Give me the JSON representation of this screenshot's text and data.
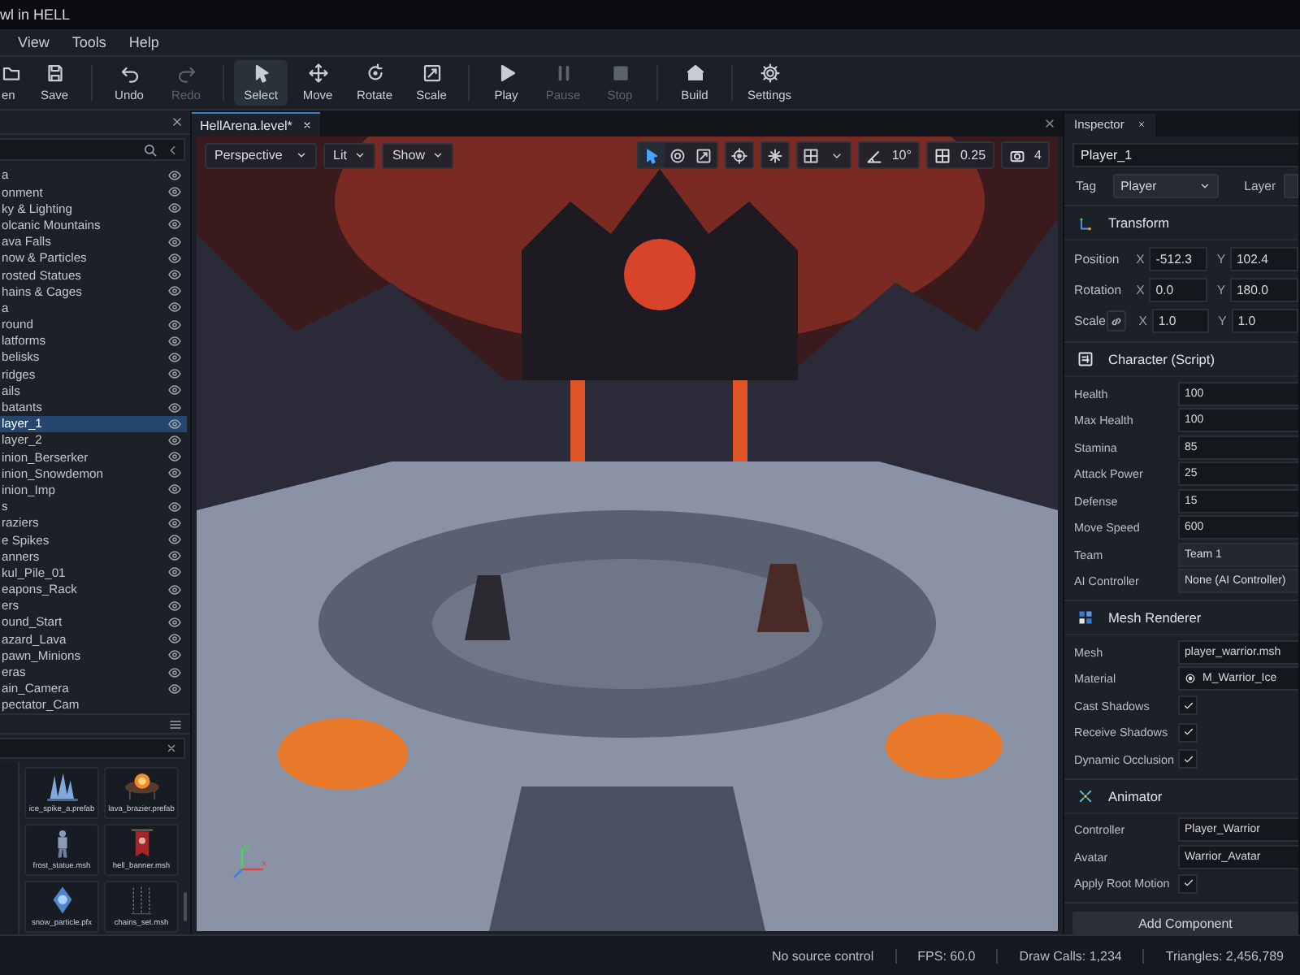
{
  "window": {
    "title": "wl in HELL"
  },
  "menu": [
    "View",
    "Tools",
    "Help"
  ],
  "toolbar": [
    {
      "label": "en",
      "kind": "open",
      "disabled": false,
      "selected": false,
      "group_end": false
    },
    {
      "label": "Save",
      "kind": "save",
      "disabled": false,
      "selected": false,
      "group_end": true
    },
    {
      "label": "Undo",
      "kind": "undo",
      "disabled": false,
      "selected": false,
      "group_end": false
    },
    {
      "label": "Redo",
      "kind": "redo",
      "disabled": true,
      "selected": false,
      "group_end": true
    },
    {
      "label": "Select",
      "kind": "select",
      "disabled": false,
      "selected": true,
      "group_end": false
    },
    {
      "label": "Move",
      "kind": "move",
      "disabled": false,
      "selected": false,
      "group_end": false
    },
    {
      "label": "Rotate",
      "kind": "rotate",
      "disabled": false,
      "selected": false,
      "group_end": false
    },
    {
      "label": "Scale",
      "kind": "scale",
      "disabled": false,
      "selected": false,
      "group_end": true
    },
    {
      "label": "Play",
      "kind": "play",
      "disabled": false,
      "selected": false,
      "group_end": false
    },
    {
      "label": "Pause",
      "kind": "pause",
      "disabled": true,
      "selected": false,
      "group_end": false
    },
    {
      "label": "Stop",
      "kind": "stop",
      "disabled": true,
      "selected": false,
      "group_end": true
    },
    {
      "label": "Build",
      "kind": "build",
      "disabled": false,
      "selected": false,
      "group_end": true
    },
    {
      "label": "Settings",
      "kind": "settings",
      "disabled": false,
      "selected": false,
      "group_end": false
    }
  ],
  "hierarchy": {
    "items": [
      {
        "label": "a",
        "visible": true,
        "selected": false
      },
      {
        "label": "onment",
        "visible": true,
        "selected": false
      },
      {
        "label": "ky & Lighting",
        "visible": true,
        "selected": false
      },
      {
        "label": "olcanic Mountains",
        "visible": true,
        "selected": false
      },
      {
        "label": "ava Falls",
        "visible": true,
        "selected": false
      },
      {
        "label": "now & Particles",
        "visible": true,
        "selected": false
      },
      {
        "label": "rosted Statues",
        "visible": true,
        "selected": false
      },
      {
        "label": "hains & Cages",
        "visible": true,
        "selected": false
      },
      {
        "label": "a",
        "visible": true,
        "selected": false
      },
      {
        "label": "round",
        "visible": true,
        "selected": false
      },
      {
        "label": "latforms",
        "visible": true,
        "selected": false
      },
      {
        "label": "belisks",
        "visible": true,
        "selected": false
      },
      {
        "label": "ridges",
        "visible": true,
        "selected": false
      },
      {
        "label": "ails",
        "visible": true,
        "selected": false
      },
      {
        "label": "batants",
        "visible": true,
        "selected": false
      },
      {
        "label": "layer_1",
        "visible": true,
        "selected": true
      },
      {
        "label": "layer_2",
        "visible": true,
        "selected": false
      },
      {
        "label": "inion_Berserker",
        "visible": true,
        "selected": false
      },
      {
        "label": "inion_Snowdemon",
        "visible": true,
        "selected": false
      },
      {
        "label": "inion_Imp",
        "visible": true,
        "selected": false
      },
      {
        "label": "s",
        "visible": true,
        "selected": false
      },
      {
        "label": "raziers",
        "visible": true,
        "selected": false
      },
      {
        "label": "e Spikes",
        "visible": true,
        "selected": false
      },
      {
        "label": "anners",
        "visible": true,
        "selected": false
      },
      {
        "label": "kul_Pile_01",
        "visible": true,
        "selected": false
      },
      {
        "label": "eapons_Rack",
        "visible": true,
        "selected": false
      },
      {
        "label": "ers",
        "visible": true,
        "selected": false
      },
      {
        "label": "ound_Start",
        "visible": true,
        "selected": false
      },
      {
        "label": "azard_Lava",
        "visible": true,
        "selected": false
      },
      {
        "label": "pawn_Minions",
        "visible": true,
        "selected": false
      },
      {
        "label": "eras",
        "visible": true,
        "selected": false
      },
      {
        "label": "ain_Camera",
        "visible": true,
        "selected": false
      },
      {
        "label": "pectator_Cam",
        "visible": false,
        "selected": false
      }
    ]
  },
  "assets": {
    "items": [
      {
        "label": "ice_spike_a.prefab",
        "kind": "picture"
      },
      {
        "label": "lava_brazier.prefab",
        "kind": "picture"
      },
      {
        "label": "frost_statue.msh",
        "kind": "picture"
      },
      {
        "label": "hell_banner.msh",
        "kind": "picture"
      },
      {
        "label": "snow_particle.pfx",
        "kind": "picture"
      },
      {
        "label": "chains_set.msh",
        "kind": "picture"
      }
    ]
  },
  "viewport": {
    "tab": {
      "label": "HellArena.level*",
      "selected": true
    },
    "view_modes": [
      "Perspective",
      "Lit",
      "Show"
    ],
    "tools": [
      {
        "kind": "select",
        "selected": true
      },
      {
        "kind": "orbit",
        "selected": false
      },
      {
        "kind": "scale",
        "selected": false
      },
      {
        "kind": "pivot",
        "selected": false
      },
      {
        "kind": "effects",
        "selected": false
      },
      {
        "kind": "grid",
        "selected": false
      }
    ],
    "snaps": [
      {
        "kind": "angle",
        "value": "10°"
      },
      {
        "kind": "grid",
        "value": "0.25"
      },
      {
        "kind": "camera",
        "value": "4"
      }
    ],
    "axis_labels": [
      "y",
      "x"
    ]
  },
  "inspector": {
    "tab": "Inspector",
    "name": "Player_1",
    "tag_label": "Tag",
    "tag": "Player",
    "layer_label": "Layer",
    "components": [
      {
        "title": "Transform",
        "kind": "transform",
        "rows": [
          {
            "kind": "vector",
            "label": "Position",
            "link": false,
            "axes": [
              {
                "axis": "X",
                "value": "-512.3"
              },
              {
                "axis": "Y",
                "value": "102.4"
              }
            ]
          },
          {
            "kind": "vector",
            "label": "Rotation",
            "link": false,
            "axes": [
              {
                "axis": "X",
                "value": "0.0"
              },
              {
                "axis": "Y",
                "value": "180.0"
              }
            ]
          },
          {
            "kind": "vector",
            "label": "Scale",
            "link": true,
            "axes": [
              {
                "axis": "X",
                "value": "1.0"
              },
              {
                "axis": "Y",
                "value": "1.0"
              }
            ]
          }
        ]
      },
      {
        "title": "Character (Script)",
        "kind": "script",
        "rows": [
          {
            "kind": "field",
            "label": "Health",
            "value": "100"
          },
          {
            "kind": "field",
            "label": "Max Health",
            "value": "100"
          },
          {
            "kind": "field",
            "label": "Stamina",
            "value": "85"
          },
          {
            "kind": "field",
            "label": "Attack Power",
            "value": "25"
          },
          {
            "kind": "field",
            "label": "Defense",
            "value": "15"
          },
          {
            "kind": "field",
            "label": "Move Speed",
            "value": "600"
          },
          {
            "kind": "dropdown",
            "label": "Team",
            "value": "Team 1"
          },
          {
            "kind": "dropdown",
            "label": "AI Controller",
            "value": "None (AI Controller)"
          }
        ]
      },
      {
        "title": "Mesh Renderer",
        "kind": "mesh",
        "rows": [
          {
            "kind": "field",
            "label": "Mesh",
            "value": "player_warrior.msh"
          },
          {
            "kind": "object",
            "label": "Material",
            "value": "M_Warrior_Ice"
          },
          {
            "kind": "check",
            "label": "Cast Shadows",
            "checked": true
          },
          {
            "kind": "check",
            "label": "Receive Shadows",
            "checked": true
          },
          {
            "kind": "check",
            "label": "Dynamic Occlusion",
            "checked": true
          }
        ]
      },
      {
        "title": "Animator",
        "kind": "animator",
        "rows": [
          {
            "kind": "field",
            "label": "Controller",
            "value": "Player_Warrior"
          },
          {
            "kind": "field",
            "label": "Avatar",
            "value": "Warrior_Avatar"
          },
          {
            "kind": "check",
            "label": "Apply Root Motion",
            "checked": true
          }
        ]
      }
    ],
    "add_button": "Add Component"
  },
  "status_bar": [
    "No source control",
    "FPS: 60.0",
    "Draw Calls: 1,234",
    "Triangles: 2,456,789"
  ]
}
